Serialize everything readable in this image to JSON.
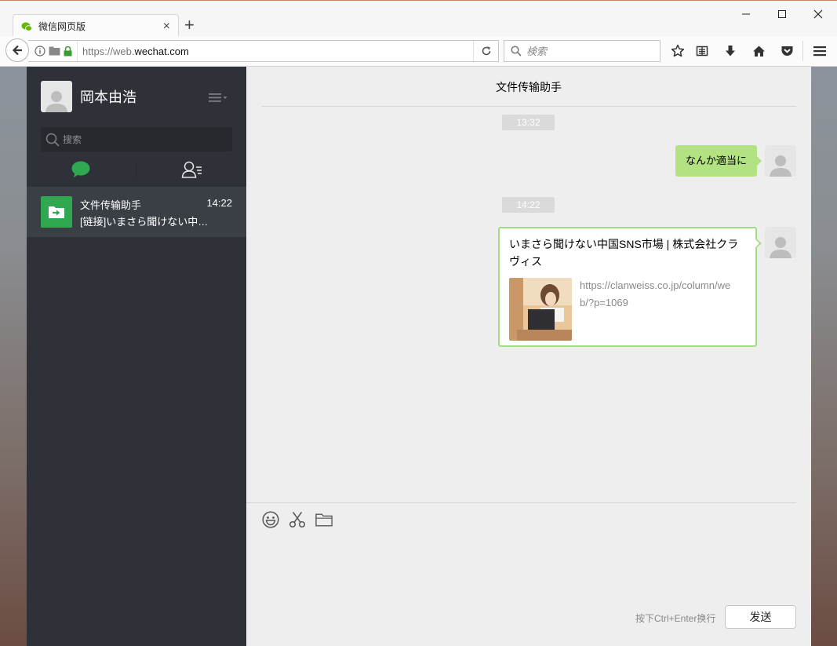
{
  "browser": {
    "tab_title": "微信网页版",
    "url_scheme": "https://web.",
    "url_host": "wechat.com",
    "search_placeholder": "検索"
  },
  "app": {
    "profile_name": "岡本由浩",
    "search_placeholder": "搜索",
    "conversations": [
      {
        "name": "文件传输助手",
        "time": "14:22",
        "preview": "[链接]いまさら聞けない中国SNS市場 | 株式会社クラヴィス"
      }
    ]
  },
  "chat": {
    "title": "文件传输助手",
    "messages": [
      {
        "type": "timestamp",
        "text": "13:32"
      },
      {
        "type": "text",
        "text": "なんか適当に"
      },
      {
        "type": "timestamp",
        "text": "14:22"
      },
      {
        "type": "link",
        "title": "いまさら聞けない中国SNS市場 | 株式会社クラヴィス",
        "url": "https://clanweiss.co.jp/column/web/?p=1069"
      }
    ],
    "send_hint": "按下Ctrl+Enter换行",
    "send_label": "发送"
  },
  "icons": {
    "tab_favicon": "wechat-logo-icon",
    "back": "back-arrow-icon",
    "reload": "reload-icon",
    "bookmark": "star-icon",
    "reading_list": "reading-list-icon",
    "download": "download-icon",
    "home": "home-icon",
    "pocket": "pocket-icon",
    "menu": "hamburger-menu-icon",
    "chat_tab": "chat-bubble-icon",
    "contacts_tab": "contacts-icon",
    "emoji": "emoji-icon",
    "screenshot": "scissors-icon",
    "file": "folder-icon"
  },
  "colors": {
    "sidebar_bg": "#2e3238",
    "chat_bg": "#eeeeee",
    "bubble_green": "#b2e281",
    "accent_green": "#2fa84f"
  }
}
